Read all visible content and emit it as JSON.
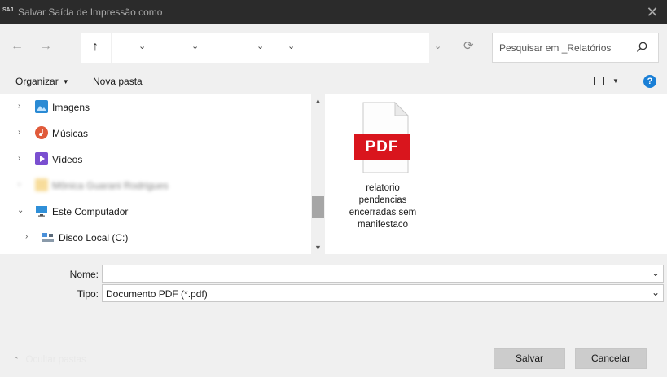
{
  "window": {
    "app_icon_text": "SAJ",
    "title": "Salvar Saída de Impressão como",
    "close_glyph": "✕"
  },
  "navigation": {
    "back_glyph": "←",
    "forward_glyph": "→",
    "up_glyph": "↑",
    "address_crumb_chevrons": [
      "⌄",
      "⌄",
      "⌄",
      "⌄"
    ],
    "address_dropdown_glyph": "⌄",
    "refresh_glyph": "⟳",
    "search_placeholder": "Pesquisar em _Relatórios"
  },
  "toolbar": {
    "organize_label": "Organizar",
    "organize_caret": "▼",
    "new_folder_label": "Nova pasta",
    "view_caret": "▼",
    "help_glyph": "?"
  },
  "navpane": {
    "items": [
      {
        "label": "Imagens",
        "expander": "›",
        "icon": "pictures-icon",
        "color": "#2a8ad4"
      },
      {
        "label": "Músicas",
        "expander": "›",
        "icon": "music-icon",
        "color": "#e05a3a"
      },
      {
        "label": "Vídeos",
        "expander": "›",
        "icon": "videos-icon",
        "color": "#7a4fd0"
      },
      {
        "label": "Mônica Guarani Rodrigues",
        "expander": "›",
        "icon": "user-folder-icon",
        "color": "#f2c14a"
      },
      {
        "label": "Este Computador",
        "expander": "⌄",
        "icon": "computer-icon",
        "color": "#2f8fd8"
      },
      {
        "label": "Disco Local (C:)",
        "expander": "›",
        "icon": "drive-icon",
        "color": "#4a6fa5"
      }
    ],
    "scroll_up_glyph": "▲",
    "scroll_down_glyph": "▼"
  },
  "files": [
    {
      "badge": "PDF",
      "name": "relatorio pendencias encerradas sem manifestaco",
      "icon": "pdf-file-icon",
      "badge_color": "#d9151d"
    }
  ],
  "form": {
    "name_label": "Nome:",
    "name_value": "",
    "type_label": "Tipo:",
    "type_value": "Documento PDF (*.pdf)",
    "dropdown_glyph": "⌄"
  },
  "footer": {
    "hide_folders_chevron": "⌃",
    "hide_folders_label": "Ocultar pastas",
    "save_label": "Salvar",
    "cancel_label": "Cancelar"
  }
}
